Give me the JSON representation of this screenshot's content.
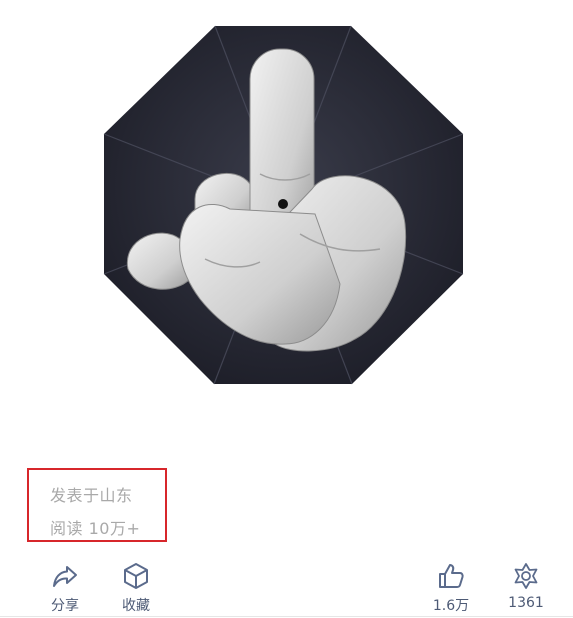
{
  "post": {
    "image_icon": "umbrella-middle-finger-photo",
    "location_text": "发表于山东",
    "read_label": "阅读",
    "read_count": "10万+"
  },
  "actions": {
    "share": {
      "label": "分享",
      "icon": "share-arrow-icon"
    },
    "favorite": {
      "label": "收藏",
      "icon": "cube-icon"
    },
    "like": {
      "count": "1.6万",
      "icon": "thumbs-up-icon"
    },
    "watch": {
      "count": "1361",
      "icon": "flower-icon"
    }
  },
  "colors": {
    "highlight_border": "#d7262b",
    "meta_text": "#a9a9a9",
    "action_text": "#4d5a75",
    "icon_stroke": "#5b6b8c"
  }
}
